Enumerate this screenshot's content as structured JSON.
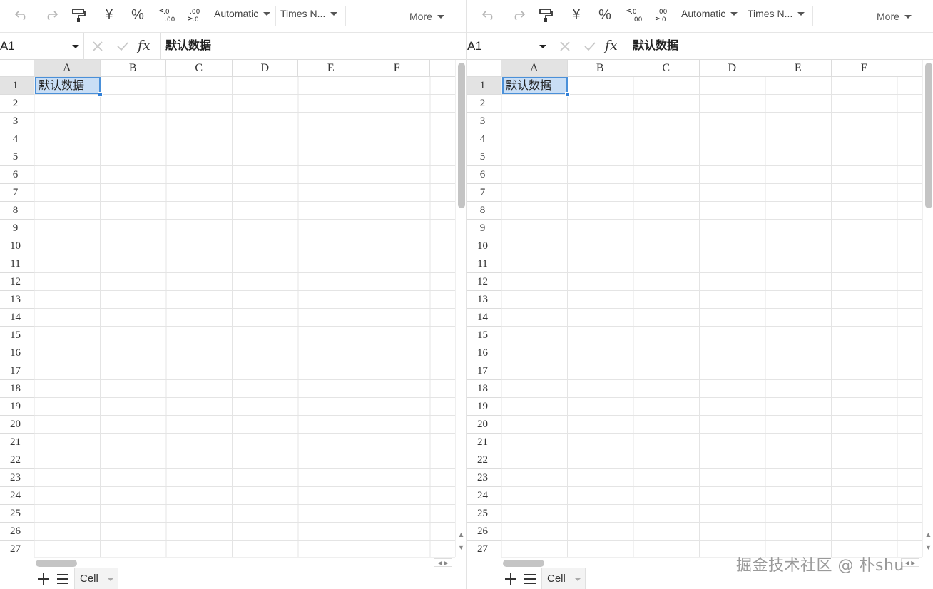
{
  "panes": [
    {
      "id": "left",
      "toolbar": {
        "yen": "¥",
        "percent": "%",
        "number_format": "Automatic",
        "font_name": "Times N...",
        "more": "More"
      },
      "formula_bar": {
        "name_box": "A1",
        "fx": "fx",
        "value": "默认数据"
      },
      "columns": [
        "A",
        "B",
        "C",
        "D",
        "E",
        "F"
      ],
      "rows": [
        "1",
        "2",
        "3",
        "4",
        "5",
        "6",
        "7",
        "8",
        "9",
        "10",
        "11",
        "12",
        "13",
        "14",
        "15",
        "16",
        "17",
        "18",
        "19",
        "20",
        "21",
        "22",
        "23",
        "24",
        "25",
        "26",
        "27"
      ],
      "selected_cell": "A1",
      "cell_a1": "默认数据",
      "sheet_tab": "Cell"
    },
    {
      "id": "right",
      "toolbar": {
        "yen": "¥",
        "percent": "%",
        "number_format": "Automatic",
        "font_name": "Times N...",
        "more": "More"
      },
      "formula_bar": {
        "name_box": "A1",
        "fx": "fx",
        "value": "默认数据"
      },
      "columns": [
        "A",
        "B",
        "C",
        "D",
        "E",
        "F"
      ],
      "rows": [
        "1",
        "2",
        "3",
        "4",
        "5",
        "6",
        "7",
        "8",
        "9",
        "10",
        "11",
        "12",
        "13",
        "14",
        "15",
        "16",
        "17",
        "18",
        "19",
        "20",
        "21",
        "22",
        "23",
        "24",
        "25",
        "26",
        "27"
      ],
      "selected_cell": "A1",
      "cell_a1": "默认数据",
      "sheet_tab": "Cell"
    }
  ],
  "watermark": "掘金技术社区 @ 朴shu",
  "colors": {
    "selection_fill": "#c9def5",
    "selection_border": "#4a90d9",
    "header_active": "#e3e3e3",
    "gridline": "#e4e4e4"
  }
}
